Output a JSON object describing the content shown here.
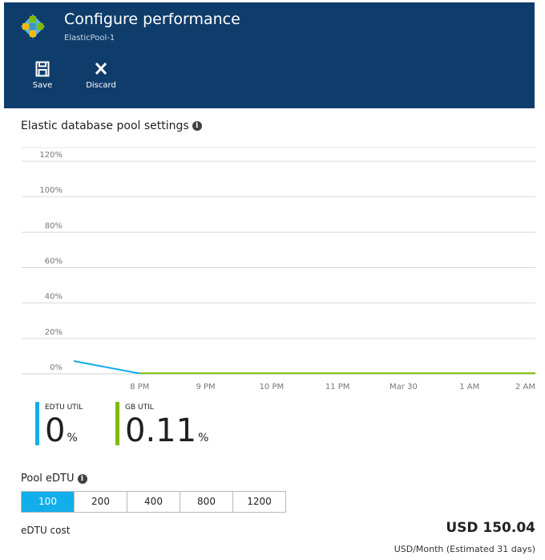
{
  "header": {
    "title": "Configure performance",
    "subtitle": "ElasticPool-1",
    "bg_color": "#0f3d6b",
    "logo_icon": "sql-elastic-pool-icon",
    "commands": [
      {
        "label": "Save",
        "icon": "save-icon"
      },
      {
        "label": "Discard",
        "icon": "close-icon"
      }
    ]
  },
  "section": {
    "title": "Elastic database pool settings",
    "info_icon": "info-icon"
  },
  "chart_data": {
    "type": "line",
    "title": "",
    "xlabel": "",
    "ylabel": "",
    "y_ticks": [
      "120%",
      "100%",
      "80%",
      "60%",
      "40%",
      "20%",
      "0%"
    ],
    "ylim": [
      0,
      120
    ],
    "x_ticks": [
      "8 PM",
      "9 PM",
      "10 PM",
      "11 PM",
      "Mar 30",
      "1 AM",
      "2 AM"
    ],
    "xlim": [
      -1.0,
      6.0
    ],
    "grid": true,
    "series": [
      {
        "name": "EDTU UTIL",
        "color": "#12aeea",
        "x": [
          -1.0,
          0.0
        ],
        "y": [
          7,
          0
        ]
      },
      {
        "name": "GB UTIL",
        "color": "#7fba00",
        "x": [
          0.0,
          6.0
        ],
        "y": [
          0.11,
          0.11
        ]
      }
    ]
  },
  "metrics": [
    {
      "label": "EDTU UTIL",
      "value": "0",
      "unit": "%",
      "color": "#12aeea"
    },
    {
      "label": "GB UTIL",
      "value": "0.11",
      "unit": "%",
      "color": "#7fba00"
    }
  ],
  "pool": {
    "label": "Pool eDTU",
    "options": [
      "100",
      "200",
      "400",
      "800",
      "1200"
    ],
    "selected": "100",
    "accent": "#12aeea"
  },
  "cost": {
    "label": "eDTU cost",
    "value": "USD 150.04",
    "note": "USD/Month (Estimated 31 days)"
  }
}
